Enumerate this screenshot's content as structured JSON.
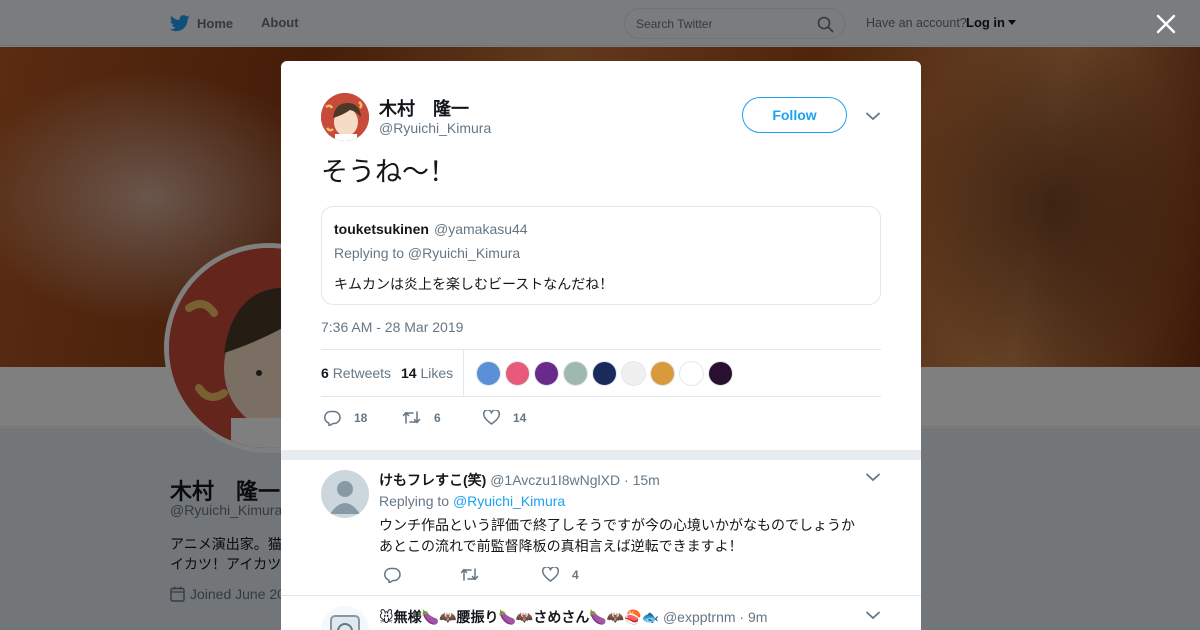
{
  "nav": {
    "home_label": "Home",
    "about_label": "About",
    "search_placeholder": "Search Twitter",
    "account_prompt": "Have an account?",
    "login_label": "Log in"
  },
  "profile": {
    "name": "木村　隆一",
    "handle": "@Ryuichi_Kimura",
    "bio": "アニメ演出家。猫\nイカツ！アイカツ",
    "joined": "Joined June 20"
  },
  "tweet": {
    "author_name": "木村　隆一",
    "author_handle": "@Ryuichi_Kimura",
    "follow_label": "Follow",
    "text": "そうね〜！",
    "timestamp": "7:36 AM - 28 Mar 2019",
    "retweets_count": "6",
    "retweets_label": "Retweets",
    "likes_count": "14",
    "likes_label": "Likes",
    "quote": {
      "name": "touketsukinen",
      "handle": "@yamakasu44",
      "replying_to": "Replying to @Ryuichi_Kimura",
      "text": "キムカンは炎上を楽しむビーストなんだね！"
    },
    "actions": {
      "replies": "18",
      "retweets": "6",
      "likes": "14"
    }
  },
  "likers": [
    {
      "name": "liker-1",
      "color": "#5b8fd6"
    },
    {
      "name": "liker-2",
      "color": "#e85a7a"
    },
    {
      "name": "liker-3",
      "color": "#6a2a8a"
    },
    {
      "name": "liker-4",
      "color": "#9fb8b0"
    },
    {
      "name": "liker-5",
      "color": "#1a2a5a"
    },
    {
      "name": "liker-6",
      "color": "#f0f0f0"
    },
    {
      "name": "liker-7",
      "color": "#d89a3a"
    },
    {
      "name": "liker-8",
      "color": "#ffffff"
    },
    {
      "name": "liker-9",
      "color": "#2a1030"
    }
  ],
  "replies": [
    {
      "name": "けもフレすこ(笑)",
      "handle": "@1Avczu1I8wNglXD",
      "time": "· 15m",
      "replying_prefix": "Replying to",
      "replying_handle": "@Ryuichi_Kimura",
      "text": "ウンチ作品という評価で終了しそうですが今の心境いかがなものでしょうか\nあとこの流れで前監督降板の真相言えば逆転できますよ！",
      "reply_count": "",
      "retweet_count": "",
      "like_count": "4"
    },
    {
      "name": "🐭無様🍆🦇腰振り🍆🦇さめさん🍆🦇🍣🐟",
      "handle": "@expptrnm",
      "time": "· 9m"
    }
  ],
  "colors": {
    "accent": "#1da1f2",
    "text": "#14171a",
    "muted": "#657786",
    "border": "#e1e8ed"
  },
  "icons": [
    "twitter-bird-icon",
    "search-icon",
    "close-icon",
    "chevron-down-icon",
    "reply-icon",
    "retweet-icon",
    "heart-icon",
    "calendar-icon"
  ]
}
